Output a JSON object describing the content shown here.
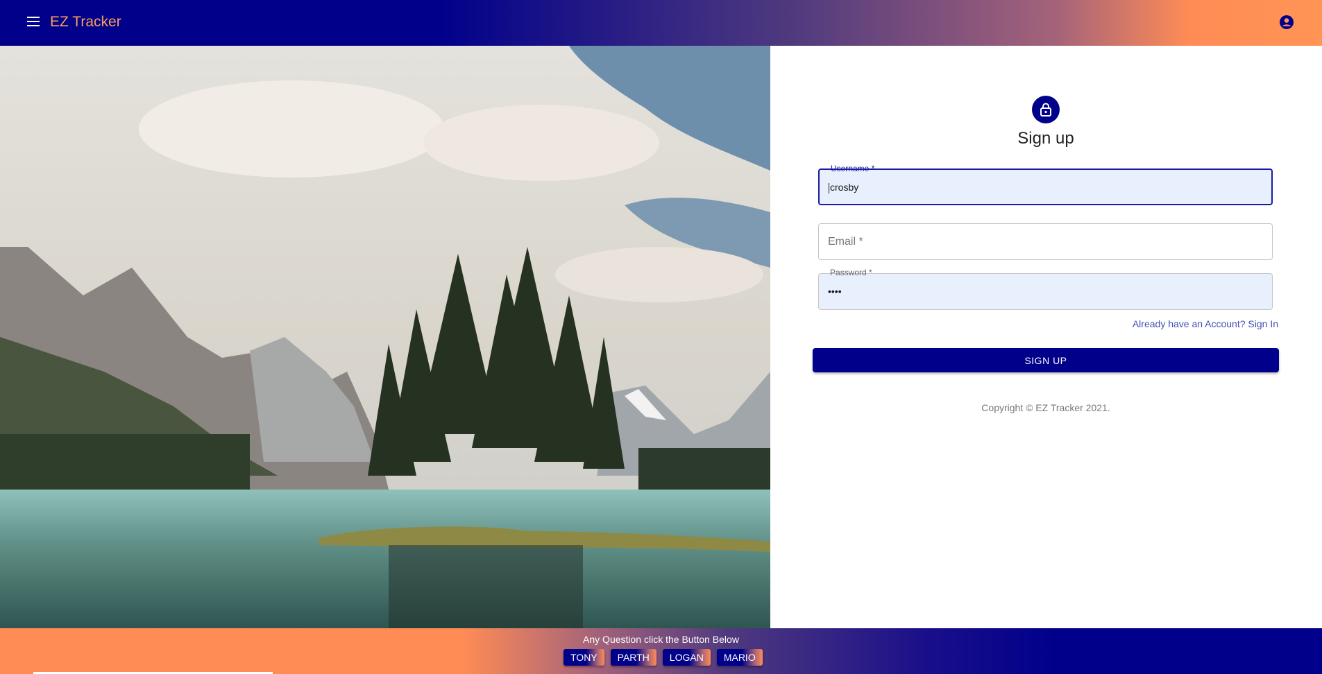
{
  "appbar": {
    "title": "EZ Tracker",
    "menu_icon": "menu-icon",
    "account_icon": "account-circle-icon"
  },
  "hero": {
    "scene": "lake-mountain-photo"
  },
  "form": {
    "lock_icon": "lock-icon",
    "title": "Sign up",
    "username": {
      "label": "Username *",
      "value": "crosby"
    },
    "email": {
      "placeholder": "Email *",
      "value": ""
    },
    "password": {
      "label": "Password *",
      "value": "••••"
    },
    "signin_link": "Already have an Account? Sign In",
    "submit_label": "SIGN UP",
    "copyright": "Copyright © EZ Tracker 2021."
  },
  "footer": {
    "text": "Any Question click the Button Below",
    "contacts": [
      "TONY",
      "PARTH",
      "LOGAN",
      "MARIO"
    ]
  },
  "colors": {
    "primary": "#00008b",
    "accent": "#ff8c55",
    "link": "#3f51b5"
  }
}
